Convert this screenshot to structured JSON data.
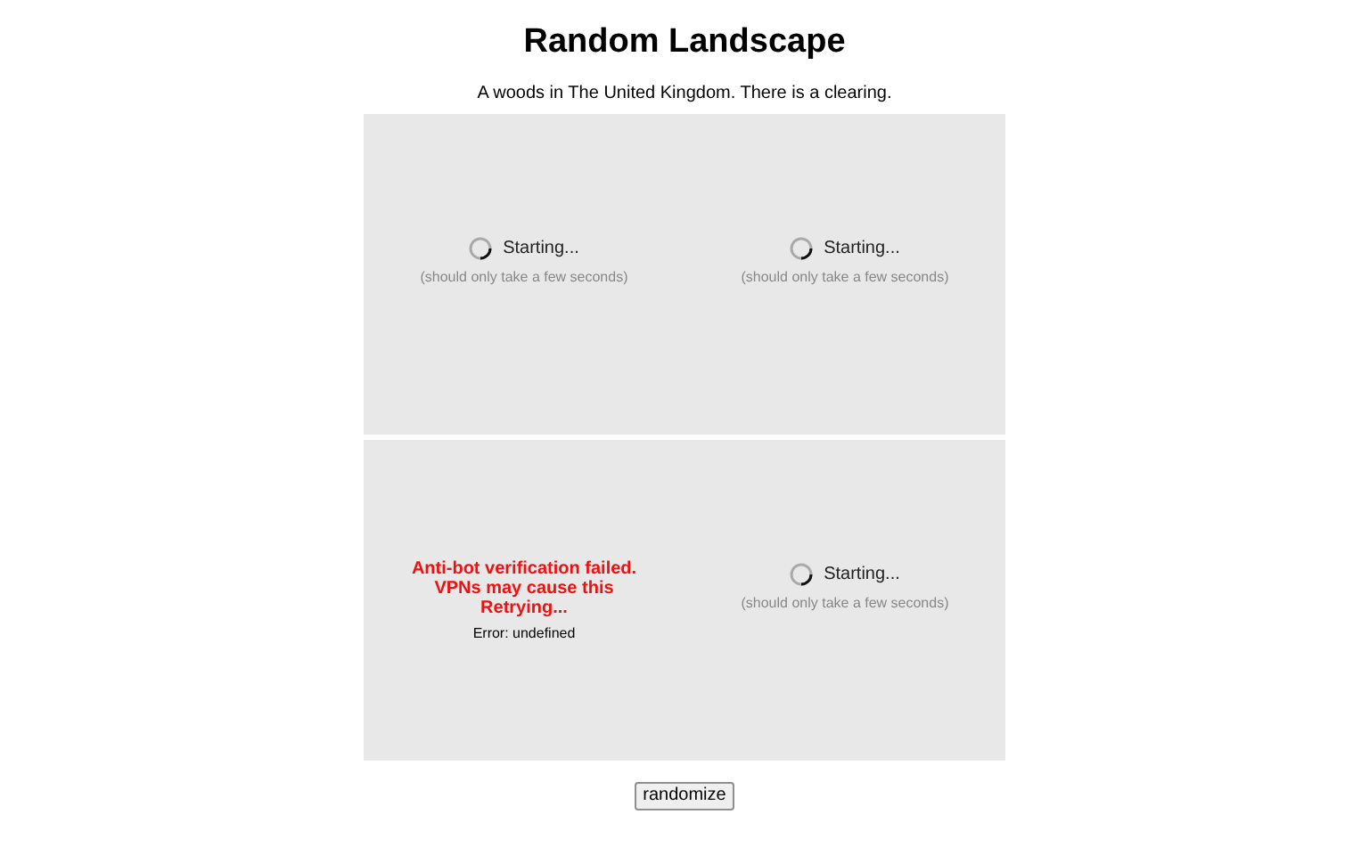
{
  "title": "Random Landscape",
  "description": "A woods in The United Kingdom. There is a clearing.",
  "tiles": [
    {
      "kind": "loading",
      "status": "Starting...",
      "hint": "(should only take a few seconds)"
    },
    {
      "kind": "loading",
      "status": "Starting...",
      "hint": "(should only take a few seconds)"
    },
    {
      "kind": "error",
      "message": "Anti-bot verification failed. VPNs may cause this",
      "retry": "Retrying...",
      "detail": "Error: undefined"
    },
    {
      "kind": "loading",
      "status": "Starting...",
      "hint": "(should only take a few seconds)"
    }
  ],
  "button": "randomize"
}
